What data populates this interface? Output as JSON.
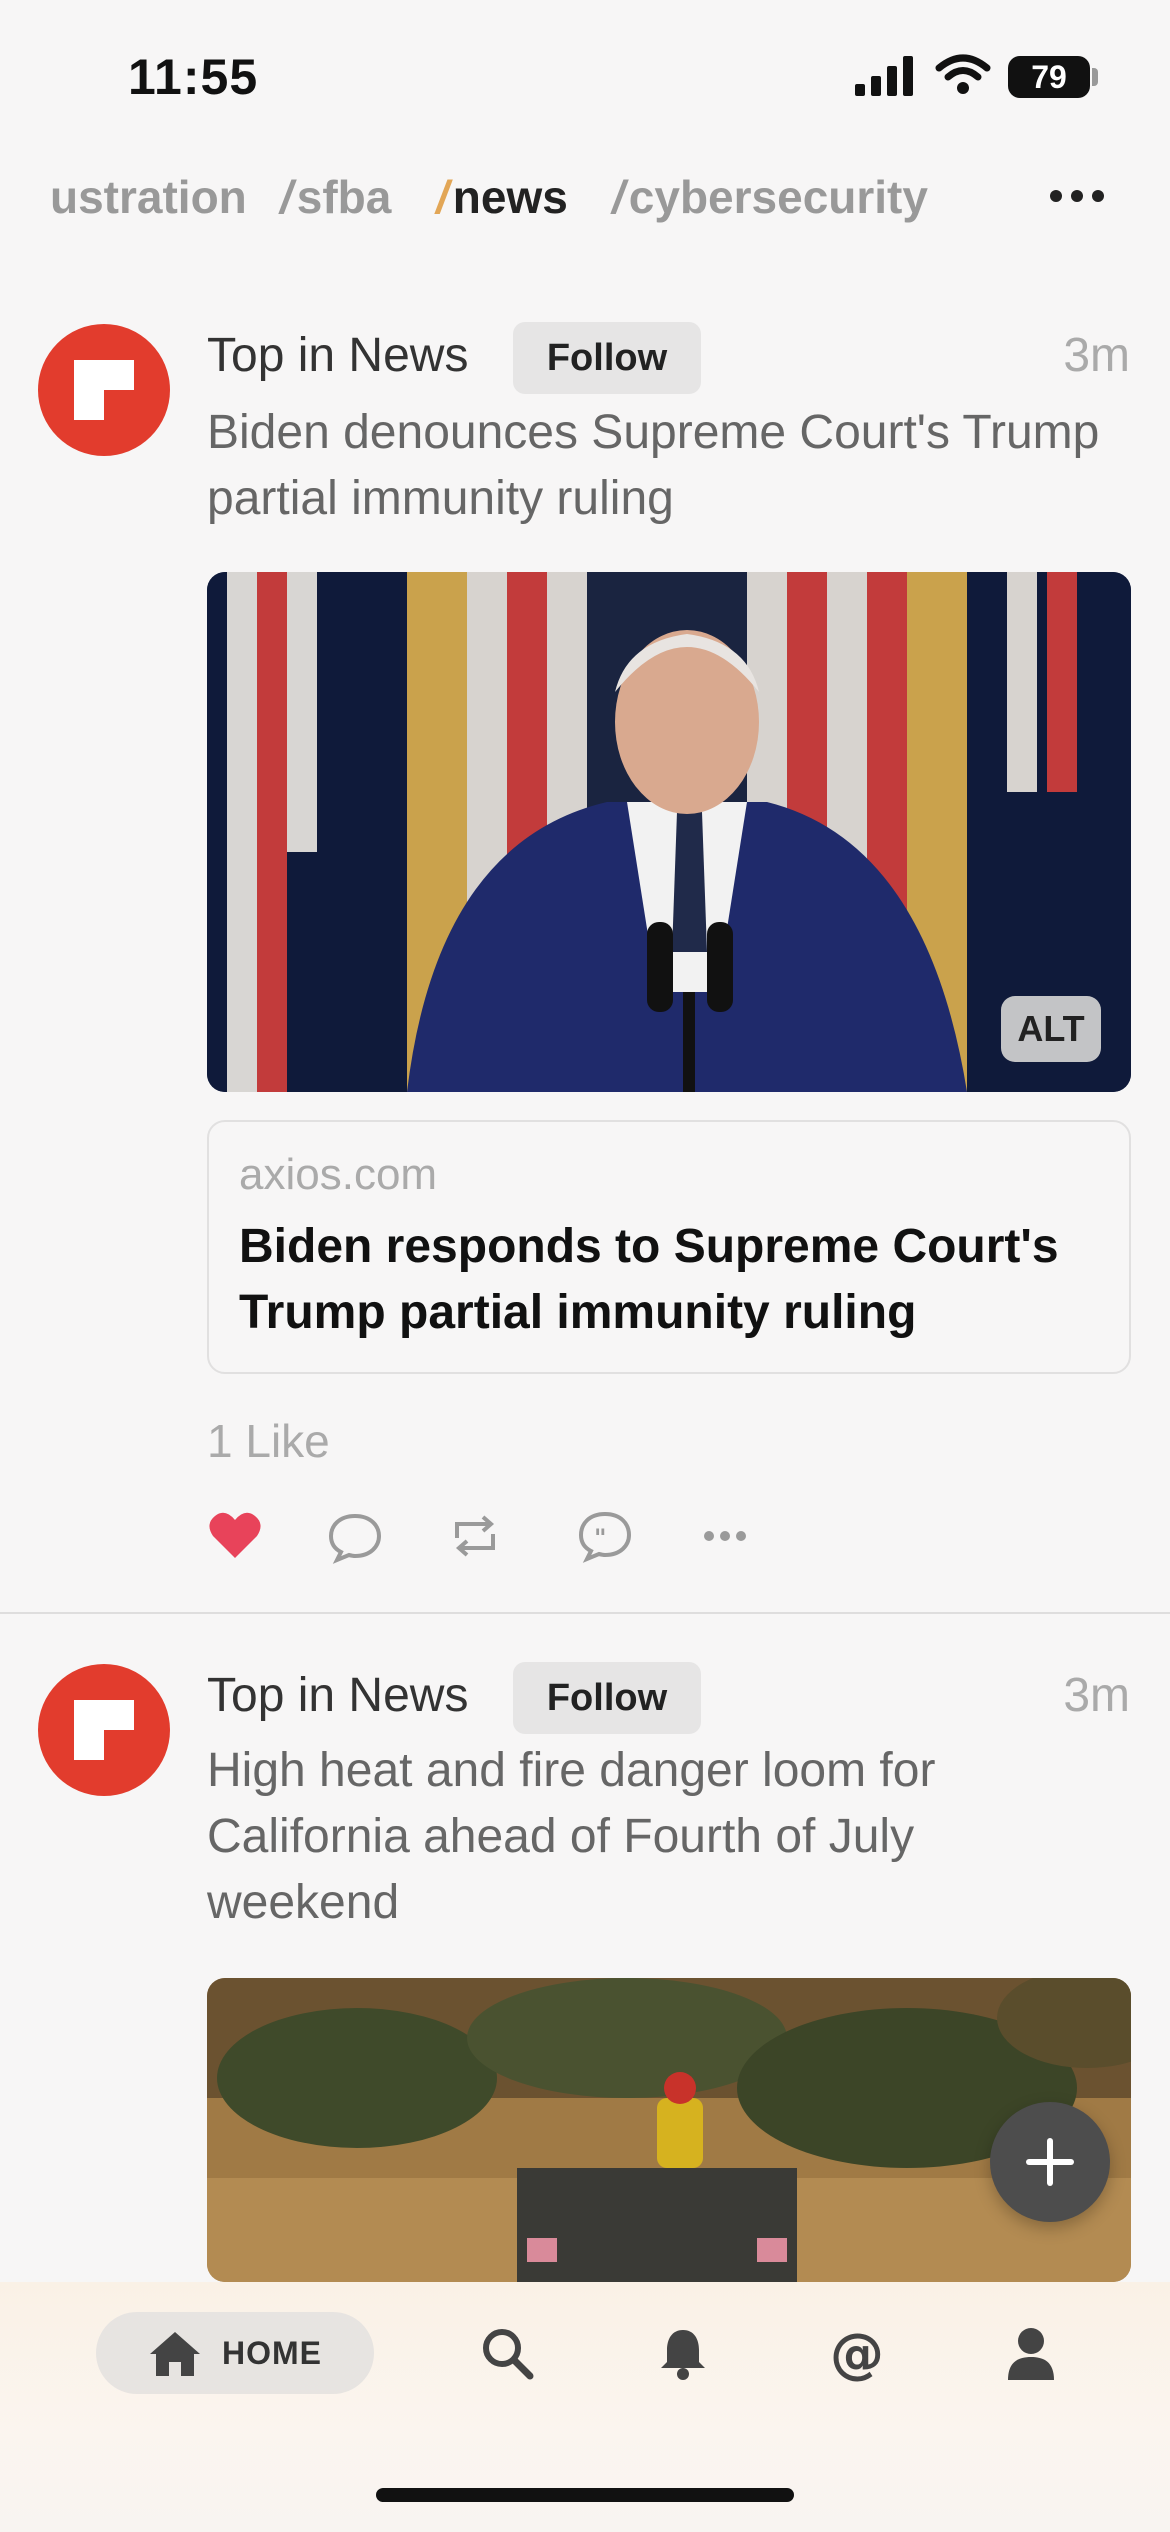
{
  "status_bar": {
    "time": "11:55",
    "battery": "79"
  },
  "tabs": [
    {
      "label": "ustration",
      "slash": "",
      "active": false
    },
    {
      "label": "sfba",
      "slash": "/",
      "active": false
    },
    {
      "label": "news",
      "slash": "/",
      "active": true
    },
    {
      "label": "cybersecurity",
      "slash": "/",
      "active": false
    }
  ],
  "posts": [
    {
      "source": "Top in News",
      "follow_label": "Follow",
      "time_ago": "3m",
      "headline": "Biden denounces Supreme Court's Trump partial immunity ruling",
      "alt_label": "ALT",
      "card_domain": "axios.com",
      "card_title": "Biden responds to Supreme Court's Trump partial immunity ruling",
      "likes": "1 Like"
    },
    {
      "source": "Top in News",
      "follow_label": "Follow",
      "time_ago": "3m",
      "headline": "High heat and fire danger loom for California ahead of Fourth of July weekend"
    }
  ],
  "bottom_nav": {
    "home_label": "HOME"
  },
  "colors": {
    "brand_red": "#e23c2d",
    "like_red": "#e8435a",
    "active_slash": "#e2a656"
  }
}
